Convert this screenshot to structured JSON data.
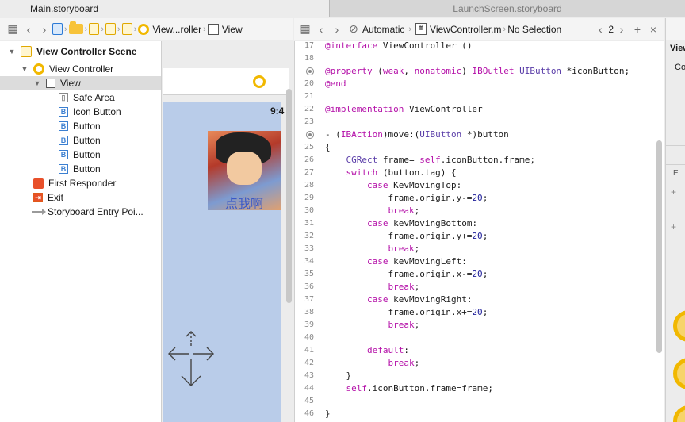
{
  "tabs": [
    {
      "label": "Main.storyboard",
      "active": true
    },
    {
      "label": "LaunchScreen.storyboard",
      "active": false
    }
  ],
  "left_jumpbar": {
    "crumbs": [
      "View...roller",
      "View"
    ]
  },
  "right_jumpbar": {
    "related": "Automatic",
    "file": "ViewController.m",
    "selection": "No Selection",
    "counter": "2"
  },
  "outline": {
    "scene": "View Controller Scene",
    "controller": "View Controller",
    "view": "View",
    "children": [
      "Safe Area",
      "Icon Button",
      "Button",
      "Button",
      "Button",
      "Button"
    ],
    "first_responder": "First Responder",
    "exit": "Exit",
    "entry_point": "Storyboard Entry Poi..."
  },
  "canvas": {
    "clock": "9:4",
    "button_title": "点我啊"
  },
  "code_lines": [
    {
      "n": "17",
      "text": "@interface ViewController ()"
    },
    {
      "n": "18",
      "text": ""
    },
    {
      "n": "19",
      "text": "@property (weak, nonatomic) IBOutlet UIButton *iconButton;",
      "marker": true
    },
    {
      "n": "20",
      "text": "@end"
    },
    {
      "n": "21",
      "text": ""
    },
    {
      "n": "22",
      "text": "@implementation ViewController"
    },
    {
      "n": "23",
      "text": ""
    },
    {
      "n": "24",
      "text": "- (IBAction)move:(UIButton *)button",
      "marker": true
    },
    {
      "n": "25",
      "text": "{"
    },
    {
      "n": "26",
      "text": "    CGRect frame= self.iconButton.frame;"
    },
    {
      "n": "27",
      "text": "    switch (button.tag) {"
    },
    {
      "n": "28",
      "text": "        case KevMovingTop:"
    },
    {
      "n": "29",
      "text": "            frame.origin.y-=20;"
    },
    {
      "n": "30",
      "text": "            break;"
    },
    {
      "n": "31",
      "text": "        case kevMovingBottom:"
    },
    {
      "n": "32",
      "text": "            frame.origin.y+=20;"
    },
    {
      "n": "33",
      "text": "            break;"
    },
    {
      "n": "34",
      "text": "        case kevMovingLeft:"
    },
    {
      "n": "35",
      "text": "            frame.origin.x-=20;"
    },
    {
      "n": "36",
      "text": "            break;"
    },
    {
      "n": "37",
      "text": "        case kevMovingRight:"
    },
    {
      "n": "38",
      "text": "            frame.origin.x+=20;"
    },
    {
      "n": "39",
      "text": "            break;"
    },
    {
      "n": "40",
      "text": ""
    },
    {
      "n": "41",
      "text": "        default:"
    },
    {
      "n": "42",
      "text": "            break;"
    },
    {
      "n": "43",
      "text": "    }"
    },
    {
      "n": "44",
      "text": "    self.iconButton.frame=frame;"
    },
    {
      "n": "45",
      "text": ""
    },
    {
      "n": "46",
      "text": "}"
    }
  ],
  "inspector": {
    "title": "View",
    "sub": "Co"
  },
  "colors": {
    "keyword": "#b40fa8",
    "type": "#5a3da8",
    "number": "#1c1c99",
    "device_bg": "#b9cce9"
  }
}
